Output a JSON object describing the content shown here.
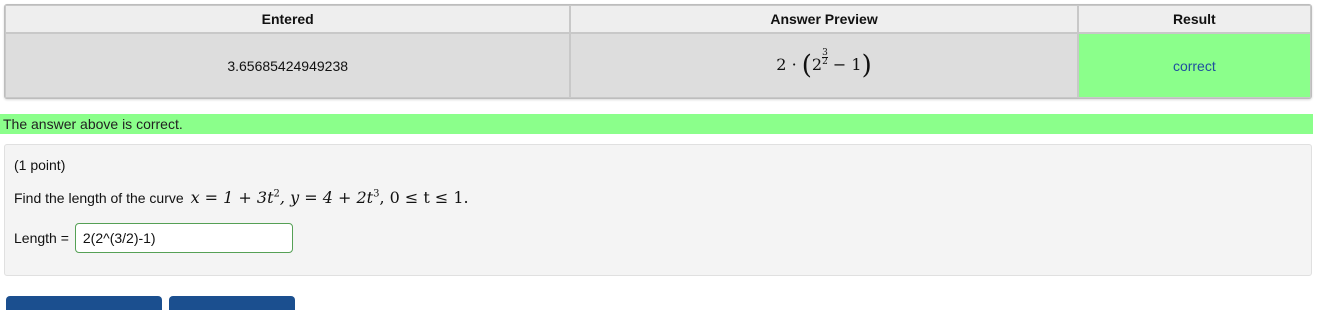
{
  "results": {
    "headers": {
      "entered": "Entered",
      "preview": "Answer Preview",
      "result": "Result"
    },
    "row": {
      "entered": "3.65685424949238",
      "preview": {
        "coef": "2",
        "dot": "·",
        "base": "2",
        "exp_num": "3",
        "exp_den": "2",
        "minus": "−",
        "one": "1"
      },
      "result": "correct"
    }
  },
  "banner": {
    "text": "The answer above is correct."
  },
  "problem": {
    "points": "(1 point)",
    "prompt": "Find the length of the curve",
    "math": {
      "x_eq": "x = 1 + 3t",
      "x_pow": "2",
      "y_eq": ",   y = 4 + 2t",
      "y_pow": "3",
      "range": ",   0 ≤ t ≤ 1."
    },
    "answer_label": "Length =",
    "answer_value": "2(2^(3/2)-1)"
  },
  "colors": {
    "correct_green": "#8bff8b",
    "button_blue": "#1b4f8f"
  }
}
